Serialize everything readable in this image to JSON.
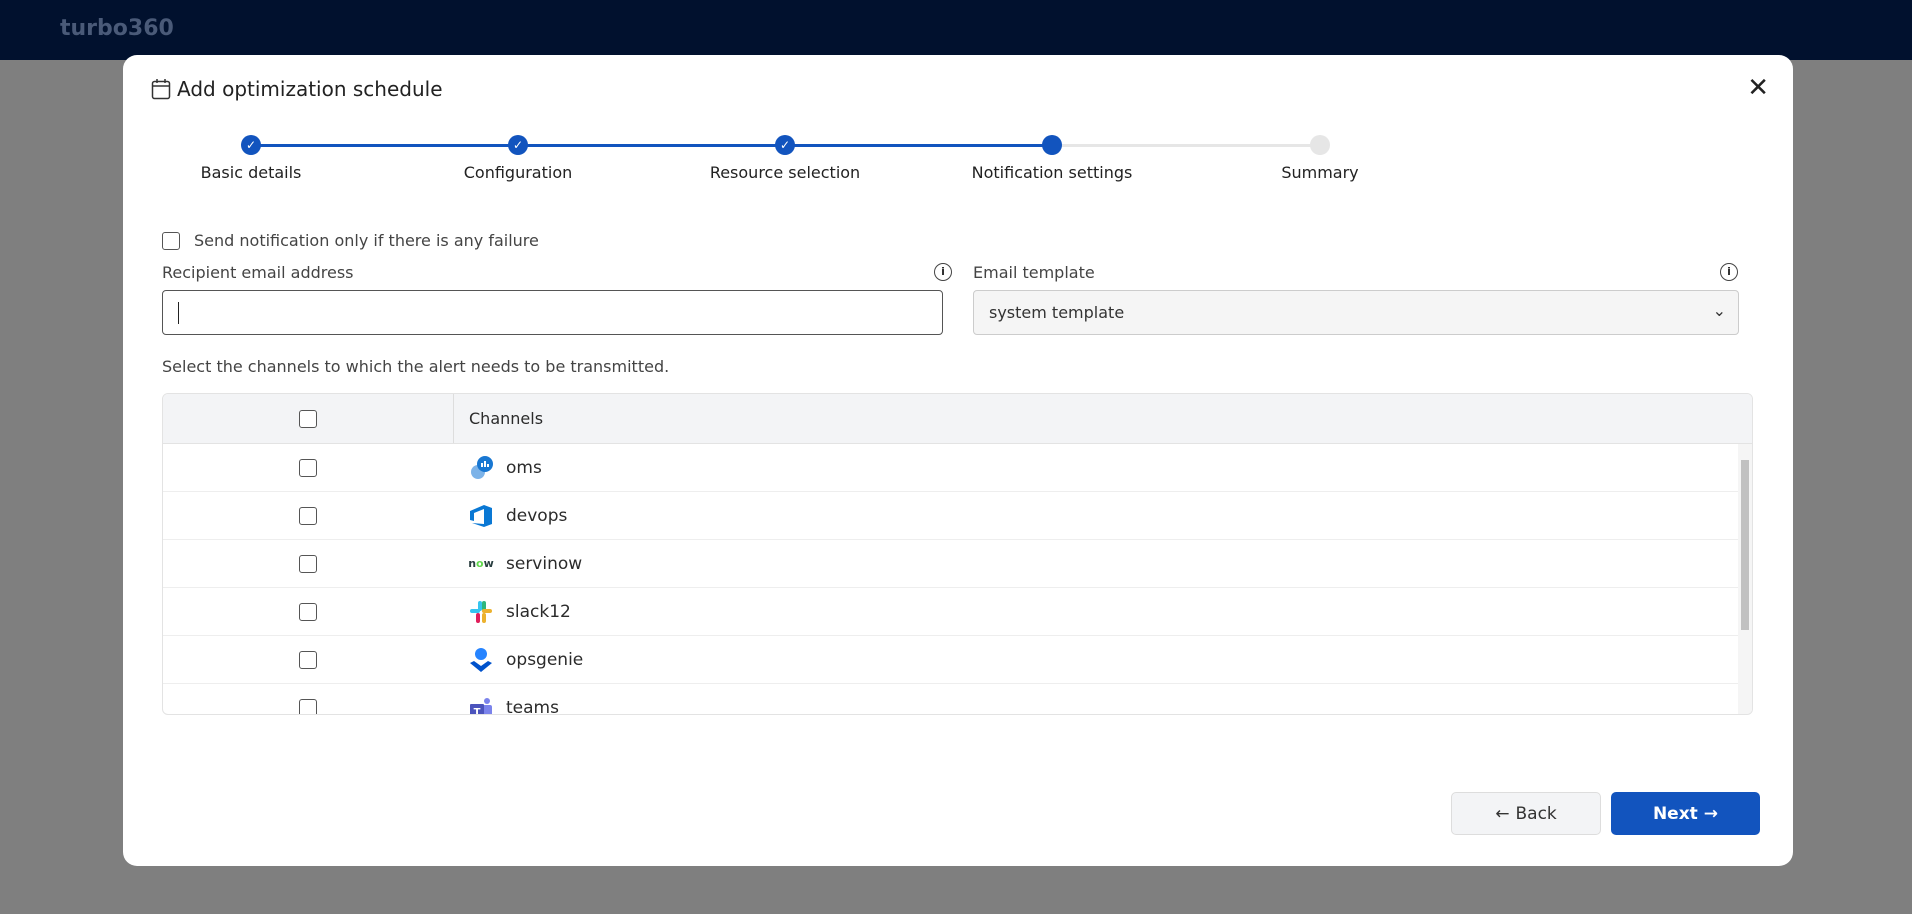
{
  "app": {
    "brand": "turbo360"
  },
  "modal": {
    "title": "Add optimization schedule",
    "steps": [
      {
        "label": "Basic details",
        "state": "done"
      },
      {
        "label": "Configuration",
        "state": "done"
      },
      {
        "label": "Resource selection",
        "state": "done"
      },
      {
        "label": "Notification settings",
        "state": "current"
      },
      {
        "label": "Summary",
        "state": "todo"
      }
    ],
    "failure_only_label": "Send notification only if there is any failure",
    "failure_only_checked": false,
    "recipient_label": "Recipient email address",
    "recipient_value": "",
    "template_label": "Email template",
    "template_value": "system template",
    "channels_hint": "Select the channels to which the alert needs to be transmitted.",
    "table": {
      "header": "Channels",
      "rows": [
        {
          "name": "oms",
          "icon": "oms-icon"
        },
        {
          "name": "devops",
          "icon": "azure-devops-icon"
        },
        {
          "name": "servinow",
          "icon": "servicenow-icon"
        },
        {
          "name": "slack12",
          "icon": "slack-icon"
        },
        {
          "name": "opsgenie",
          "icon": "opsgenie-icon"
        },
        {
          "name": "teams",
          "icon": "teams-icon"
        }
      ]
    },
    "back_label": "Back",
    "next_label": "Next",
    "accent": "#1254be"
  }
}
